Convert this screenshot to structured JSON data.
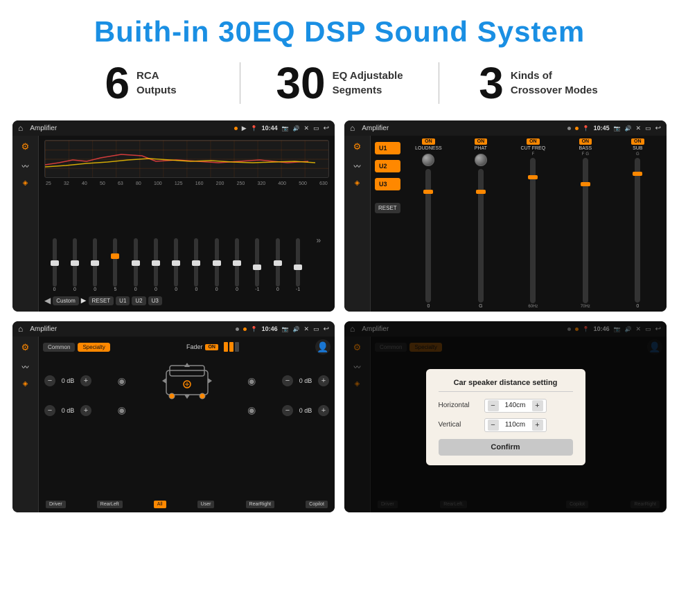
{
  "header": {
    "title": "Buith-in 30EQ DSP Sound System"
  },
  "stats": [
    {
      "number": "6",
      "text_line1": "RCA",
      "text_line2": "Outputs"
    },
    {
      "number": "30",
      "text_line1": "EQ Adjustable",
      "text_line2": "Segments"
    },
    {
      "number": "3",
      "text_line1": "Kinds of",
      "text_line2": "Crossover Modes"
    }
  ],
  "screens": {
    "eq_screen": {
      "title": "Amplifier",
      "time": "10:44",
      "freq_labels": [
        "25",
        "32",
        "40",
        "50",
        "63",
        "80",
        "100",
        "125",
        "160",
        "200",
        "250",
        "320",
        "400",
        "500",
        "630"
      ],
      "slider_values": [
        "0",
        "0",
        "0",
        "5",
        "0",
        "0",
        "0",
        "0",
        "0",
        "0",
        "-1",
        "0",
        "-1"
      ],
      "buttons": [
        "Custom",
        "RESET",
        "U1",
        "U2",
        "U3"
      ]
    },
    "crossover_screen": {
      "title": "Amplifier",
      "time": "10:45",
      "u_buttons": [
        "U1",
        "U2",
        "U3"
      ],
      "channels": [
        "LOUDNESS",
        "PHAT",
        "CUT FREQ",
        "BASS",
        "SUB"
      ],
      "on_states": [
        true,
        true,
        true,
        true,
        true
      ]
    },
    "fader_screen": {
      "title": "Amplifier",
      "time": "10:46",
      "tabs": [
        "Common",
        "Specialty"
      ],
      "fader_label": "Fader",
      "on_label": "ON",
      "vol_labels": [
        "0 dB",
        "0 dB",
        "0 dB",
        "0 dB"
      ],
      "bottom_labels": [
        "Driver",
        "RearLeft",
        "All",
        "User",
        "RearRight",
        "Copilot"
      ]
    },
    "distance_screen": {
      "title": "Amplifier",
      "time": "10:46",
      "tabs": [
        "Common",
        "Specialty"
      ],
      "dialog": {
        "title": "Car speaker distance setting",
        "rows": [
          {
            "label": "Horizontal",
            "value": "140cm"
          },
          {
            "label": "Vertical",
            "value": "110cm"
          }
        ],
        "confirm_label": "Confirm"
      },
      "bottom_labels": [
        "Driver",
        "RearLeft.",
        "Copilot",
        "RearRight"
      ]
    }
  }
}
